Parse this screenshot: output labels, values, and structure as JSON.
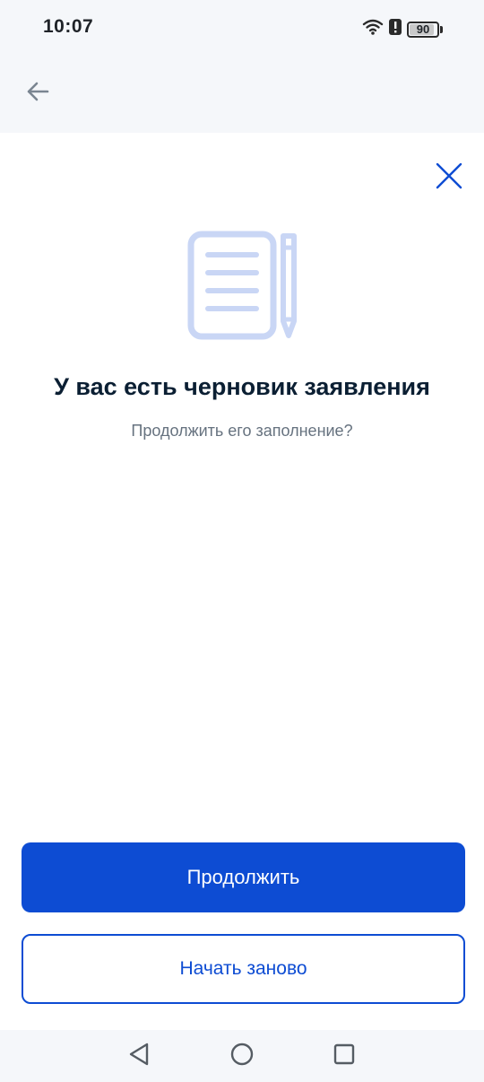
{
  "status_bar": {
    "time": "10:07",
    "battery_level": "90",
    "icons": [
      "wifi-icon",
      "alert-icon",
      "battery-icon"
    ]
  },
  "app_bar": {
    "back_icon": "arrow-left-icon"
  },
  "dialog": {
    "close_icon": "close-icon",
    "illustration_icon": "notepad-pencil-icon",
    "title": "У вас есть черновик заявления",
    "subtitle": "Продолжить его заполнение?",
    "primary_button": "Продолжить",
    "secondary_button": "Начать заново"
  },
  "nav_bar": {
    "icons": [
      "nav-back-icon",
      "nav-home-icon",
      "nav-recents-icon"
    ]
  },
  "colors": {
    "accent": "#0d4cd3",
    "title_text": "#0b1f33",
    "subtitle_text": "#66727f",
    "illustration": "#c9d6f5",
    "background_bars": "#f5f7fa"
  }
}
